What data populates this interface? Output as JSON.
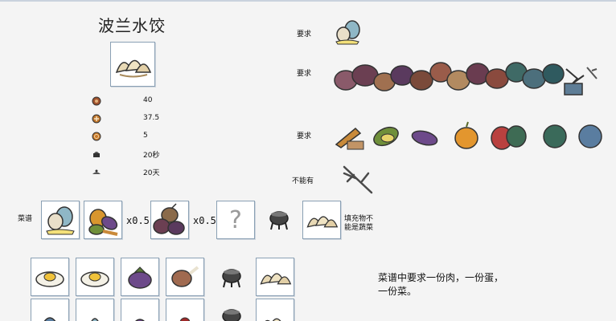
{
  "title": "波兰水饺",
  "stats": [
    {
      "icon": "hunger-icon",
      "value": "40",
      "color": "#a0522d"
    },
    {
      "icon": "health-icon",
      "value": "37.5",
      "color": "#c0762c"
    },
    {
      "icon": "sanity-icon",
      "value": "5",
      "color": "#c97a2a"
    },
    {
      "icon": "cook-time-icon",
      "value": "20秒",
      "color": "#333333"
    },
    {
      "icon": "spoil-time-icon",
      "value": "20天",
      "color": "#555555"
    }
  ],
  "requirements": {
    "label_egg": "要求",
    "label_meat": "要求",
    "label_veg": "要求",
    "label_forbidden": "不能有"
  },
  "recipe": {
    "label": "菜谱",
    "mult_a": "x0.5",
    "mult_b": "x0.5",
    "unknown": "?",
    "note": "填充物不能是蔬菜"
  },
  "description": {
    "line1": "菜谱中要求一份肉，一份蛋，",
    "line2": "一份菜。"
  }
}
